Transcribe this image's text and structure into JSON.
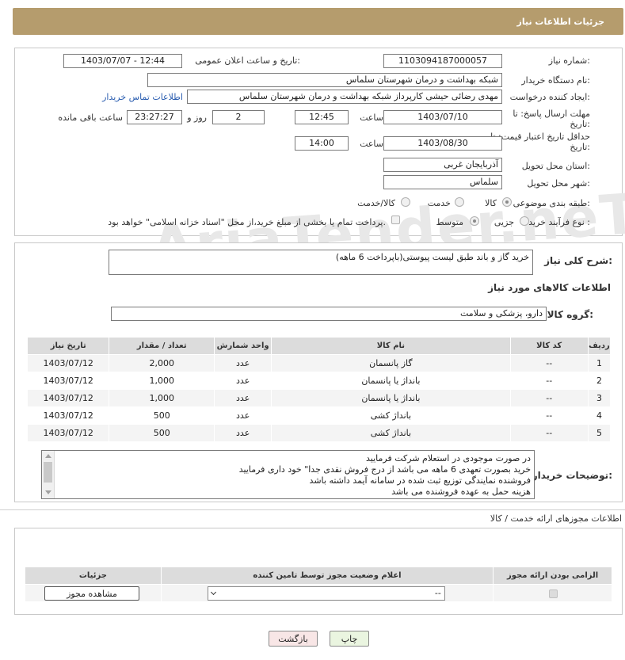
{
  "header": {
    "title": "جزئیات اطلاعات نیاز"
  },
  "watermark": {
    "text": "AriaTender.neT"
  },
  "form": {
    "need_number_label": "شماره نیاز:",
    "need_number": "1103094187000057",
    "announce_label": "تاریخ و ساعت اعلان عمومی:",
    "announce_value": "1403/07/07 - 12:44",
    "buyer_org_label": "نام دستگاه خریدار:",
    "buyer_org": "شبکه بهداشت و درمان  شهرستان سلماس",
    "creator_label": "ایجاد کننده درخواست:",
    "creator": "مهدی رضائی حیشی کارپرداز شبکه بهداشت و درمان  شهرستان سلماس",
    "contact_link": "اطلاعات تماس خریدار",
    "deadline_label": "مهلت ارسال پاسخ: تا تاریخ:",
    "deadline_date": "1403/07/10",
    "time_label": "ساعت",
    "deadline_time": "12:45",
    "days_value": "2",
    "days_label": "روز و",
    "remaining_time": "23:27:27",
    "remaining_label": "ساعت باقی مانده",
    "validity_label": "حداقل تاریخ اعتبار قیمت: تا تاریخ:",
    "validity_date": "1403/08/30",
    "validity_time": "14:00",
    "province_label": "استان محل تحویل:",
    "province": "آذربایجان غربی",
    "city_label": "شهر محل تحویل:",
    "city": "سلماس",
    "category_label": "طبقه بندی موضوعی:",
    "category_options": [
      "کالا",
      "خدمت",
      "کالا/خدمت"
    ],
    "process_label": "نوع فرآیند خرید :",
    "process_options": [
      "جزیی",
      "متوسط"
    ],
    "payment_text": "پرداخت تمام یا بخشی از مبلغ خرید،از محل \"اسناد خزانه اسلامی\" خواهد بود."
  },
  "summary": {
    "label": "شرح کلی نیاز:",
    "value": "خرید گاز و باند طبق لیست پیوستی(باپرداخت 6 ماهه)"
  },
  "goods": {
    "section_title": "اطلاعات کالاهای مورد نیاز",
    "group_label": "گروه کالا:",
    "group_value": "دارو، پزشکی و سلامت",
    "columns": [
      "ردیف",
      "کد کالا",
      "نام کالا",
      "واحد شمارش",
      "تعداد / مقدار",
      "تاریخ نیاز"
    ],
    "rows": [
      [
        "1",
        "--",
        "گاز پانسمان",
        "عدد",
        "2,000",
        "1403/07/12"
      ],
      [
        "2",
        "--",
        "بانداژ یا پانسمان",
        "عدد",
        "1,000",
        "1403/07/12"
      ],
      [
        "3",
        "--",
        "بانداژ یا پانسمان",
        "عدد",
        "1,000",
        "1403/07/12"
      ],
      [
        "4",
        "--",
        "بانداژ کشی",
        "عدد",
        "500",
        "1403/07/12"
      ],
      [
        "5",
        "--",
        "بانداژ کشی",
        "عدد",
        "500",
        "1403/07/12"
      ]
    ]
  },
  "buyer_notes": {
    "label": "توضیحات خریدار:",
    "lines": [
      "در صورت موجودی در استعلام شرکت فرمایید",
      "خرید بصورت تعهدی 6 ماهه می باشد از درج فروش نقدی جدا\" خود داری فرمایید",
      "فروشنده نمایندگی توزیع ثبت شده در سامانه آیمد داشته باشد",
      "هزینه حمل به عهده فروشنده می باشد"
    ]
  },
  "permits": {
    "section_title": "اطلاعات مجوزهای ارائه خدمت / کالا",
    "columns": [
      "الزامی بودن ارائه مجوز",
      "اعلام وضعیت مجوز توسط تامین کننده",
      "جزئیات"
    ],
    "select_value": "--",
    "view_button": "مشاهده مجوز"
  },
  "actions": {
    "print": "چاپ",
    "back": "بازگشت"
  }
}
